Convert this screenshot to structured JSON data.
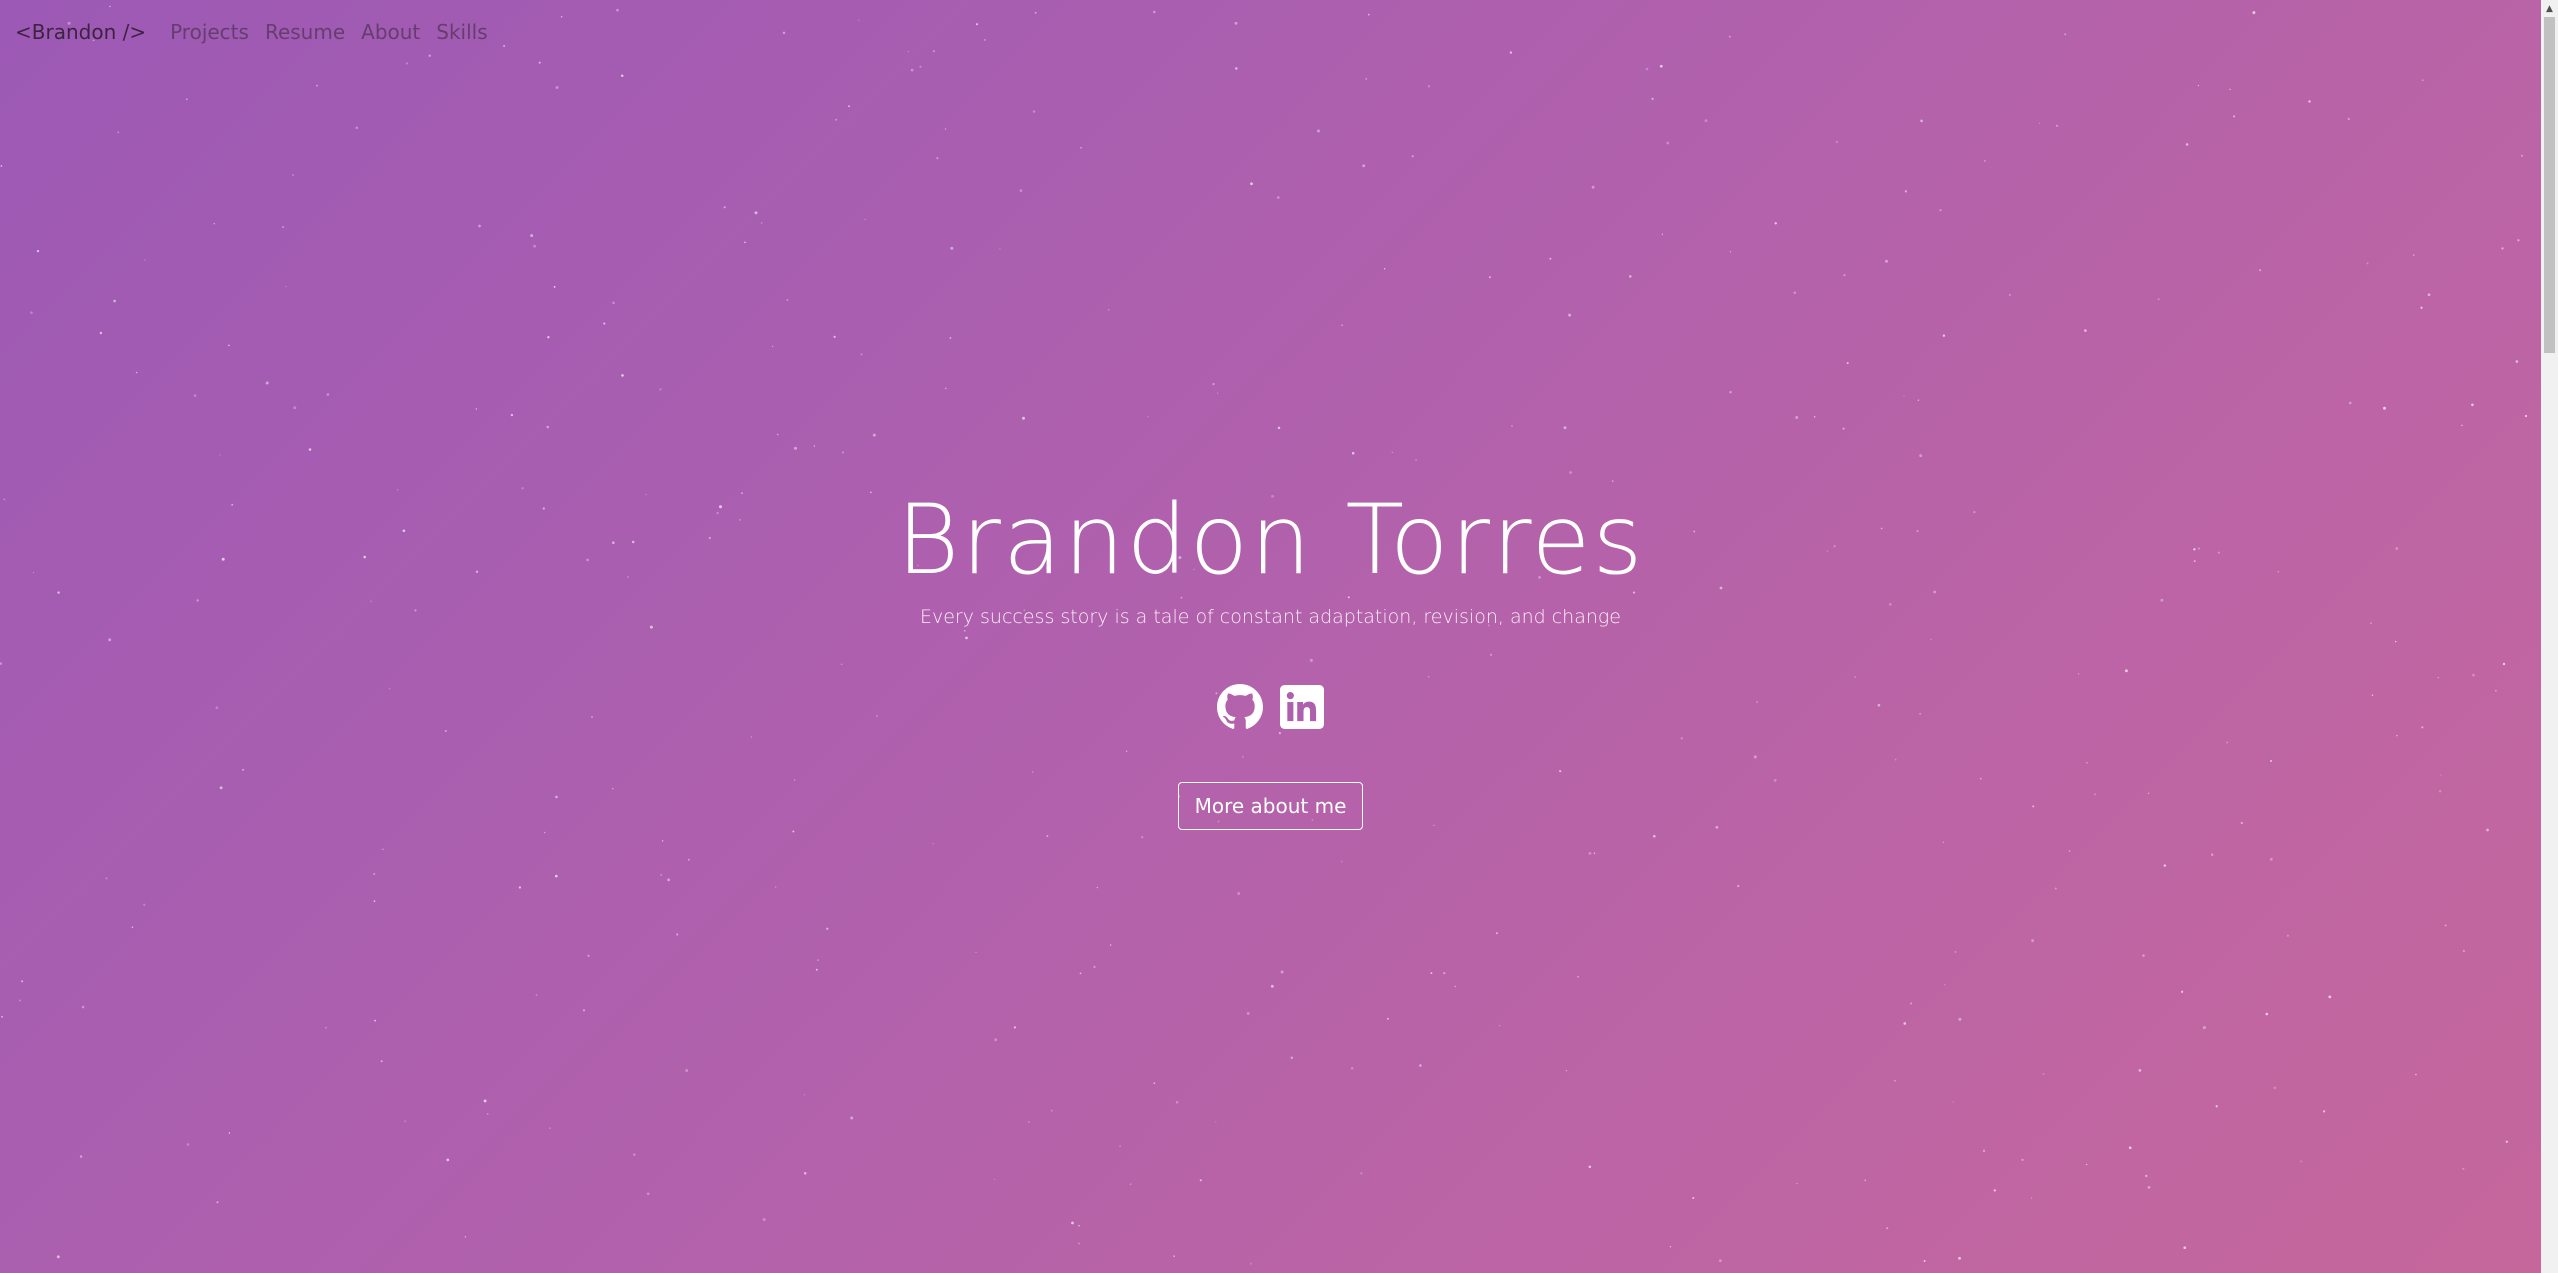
{
  "nav": {
    "brand": "<Brandon />",
    "links": [
      "Projects",
      "Resume",
      "About",
      "Skills"
    ]
  },
  "hero": {
    "name": "Brandon Torres",
    "tagline": "Every success story is a tale of constant adaptation, revision, and change",
    "cta_label": "More about me"
  },
  "socials": [
    {
      "icon": "github-icon"
    },
    {
      "icon": "linkedin-icon"
    }
  ],
  "colors": {
    "gradient_start": "#9c59b5",
    "gradient_end": "#c6679c",
    "brand_text": "#3c2440",
    "nav_text": "#5e3763"
  }
}
